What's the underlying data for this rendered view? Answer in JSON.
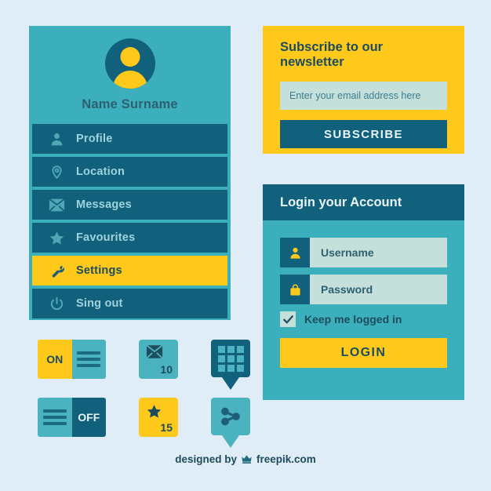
{
  "colors": {
    "page_bg": "#e0edf7",
    "teal": "#3bafbc",
    "dark_teal": "#11617d",
    "yellow": "#ffc91c",
    "mint": "#c5dfda",
    "text_dark": "#1d4c5c"
  },
  "sidebar": {
    "avatar_icon": "user-avatar-icon",
    "profile_name": "Name Surname",
    "items": [
      {
        "label": "Profile",
        "icon": "person-icon",
        "active": false
      },
      {
        "label": "Location",
        "icon": "pin-icon",
        "active": false
      },
      {
        "label": "Messages",
        "icon": "envelope-icon",
        "active": false
      },
      {
        "label": "Favourites",
        "icon": "star-icon",
        "active": false
      },
      {
        "label": "Settings",
        "icon": "wrench-icon",
        "active": true
      },
      {
        "label": "Sing out",
        "icon": "power-icon",
        "active": false
      }
    ]
  },
  "newsletter": {
    "title": "Subscribe to our newsletter",
    "email_value": "",
    "email_placeholder": "Enter your email address here",
    "button_label": "SUBSCRIBE"
  },
  "login": {
    "title": "Login your Account",
    "username_value": "Username",
    "username_icon": "person-icon",
    "password_value": "Password",
    "password_icon": "lock-icon",
    "remember_label": "Keep me logged in",
    "remember_checked": true,
    "button_label": "LOGIN"
  },
  "widgets": {
    "toggle_on_label": "ON",
    "toggle_off_label": "OFF",
    "mail_badge": {
      "icon": "envelope-icon",
      "count": "10"
    },
    "star_badge": {
      "icon": "star-icon",
      "count": "15"
    },
    "grid_bubble": {
      "icon": "apps-grid-icon"
    },
    "share_bubble": {
      "icon": "share-icon"
    }
  },
  "footer": {
    "prefix": "designed by",
    "icon": "crown-icon",
    "brand": "freepik.com"
  }
}
